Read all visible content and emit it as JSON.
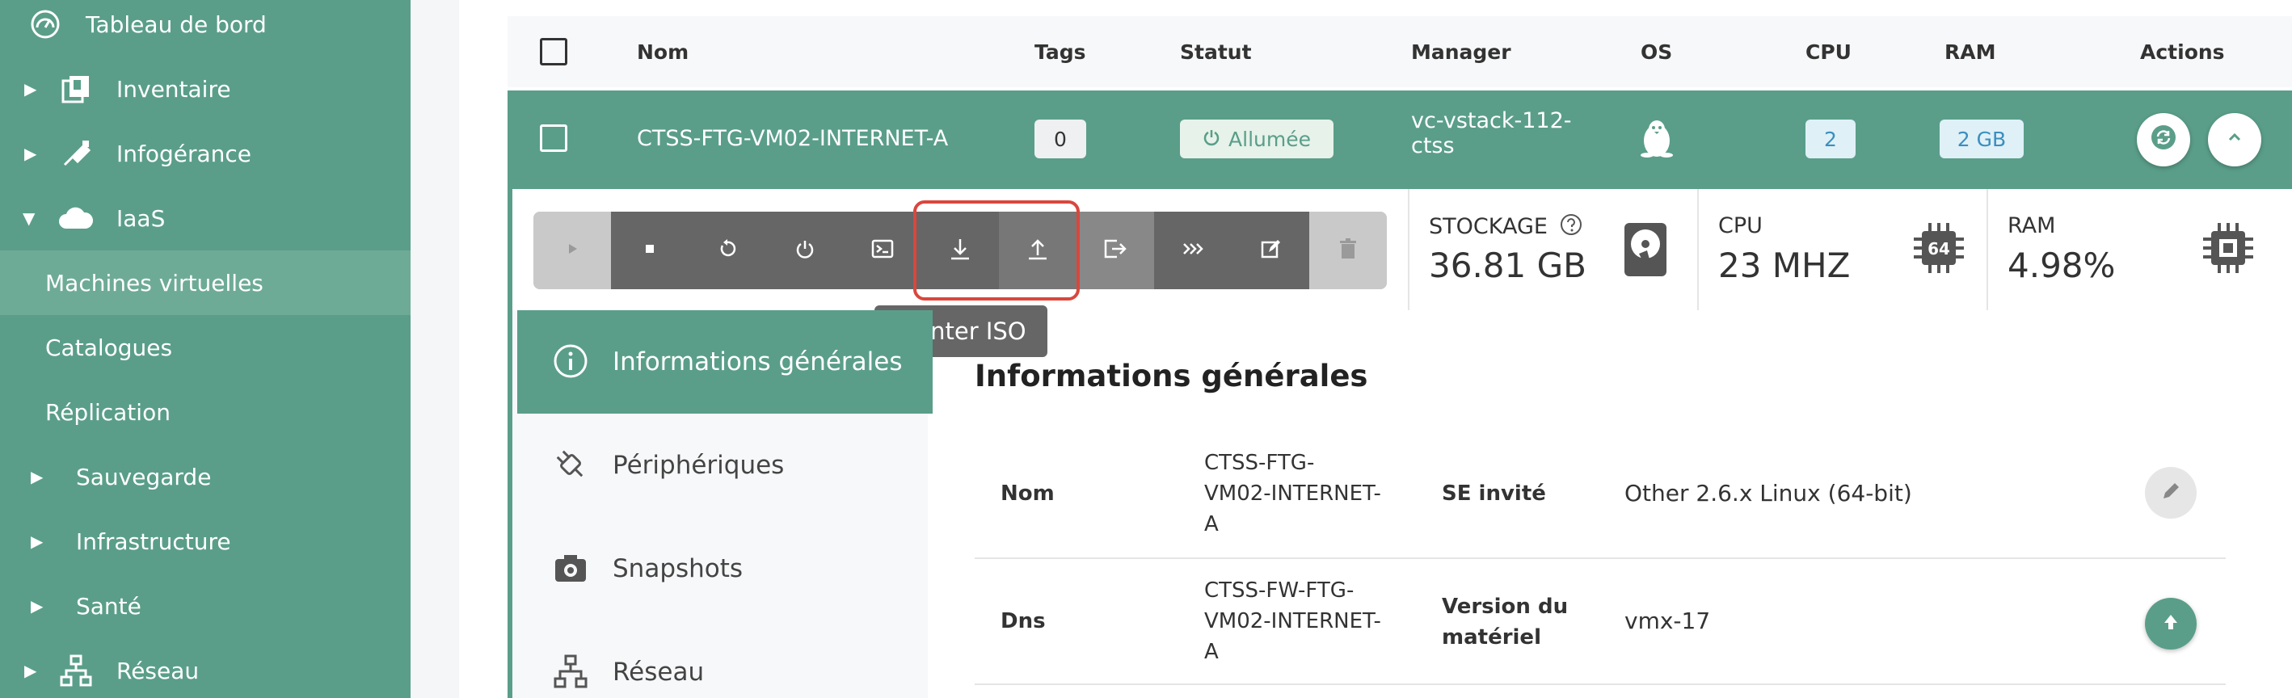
{
  "sidebar": {
    "items": [
      {
        "label": "Tableau de bord",
        "icon": "dashboard-icon"
      },
      {
        "label": "Inventaire",
        "icon": "inventory-icon"
      },
      {
        "label": "Infogérance",
        "icon": "managed-services-icon"
      },
      {
        "label": "IaaS",
        "icon": "cloud-icon"
      },
      {
        "label": "Machines virtuelles"
      },
      {
        "label": "Catalogues"
      },
      {
        "label": "Réplication"
      },
      {
        "label": "Sauvegarde"
      },
      {
        "label": "Infrastructure"
      },
      {
        "label": "Santé"
      },
      {
        "label": "Réseau",
        "icon": "network-icon"
      }
    ]
  },
  "table": {
    "headers": {
      "nom": "Nom",
      "tags": "Tags",
      "statut": "Statut",
      "manager": "Manager",
      "os": "OS",
      "cpu": "CPU",
      "ram": "RAM",
      "actions": "Actions"
    },
    "row": {
      "name": "CTSS-FTG-VM02-INTERNET-A",
      "tags": "0",
      "status": "Allumée",
      "manager_line1": "vc-vstack-112-",
      "manager_line2": "ctss",
      "os_icon": "linux-penguin-icon",
      "cpu": "2",
      "ram": "2 GB"
    }
  },
  "toolbar": {
    "buttons": [
      "play-icon",
      "stop-icon",
      "restart-icon",
      "power-icon",
      "console-icon",
      "mount-iso-icon",
      "unmount-iso-icon",
      "export-icon",
      "migrate-icon",
      "edit-icon",
      "delete-icon"
    ],
    "tooltip": "Monter ISO"
  },
  "stats": {
    "storage_label": "STOCKAGE",
    "storage_value": "36.81 GB",
    "cpu_label": "CPU",
    "cpu_value": "23 MHZ",
    "cpu_chip": "64",
    "ram_label": "RAM",
    "ram_value": "4.98%"
  },
  "tabs": [
    {
      "label": "Informations générales",
      "icon": "info-icon"
    },
    {
      "label": "Périphériques",
      "icon": "plug-icon"
    },
    {
      "label": "Snapshots",
      "icon": "camera-icon"
    },
    {
      "label": "Réseau",
      "icon": "network-icon"
    }
  ],
  "info": {
    "title": "Informations générales",
    "rows": [
      {
        "label1": "Nom",
        "value1_l1": "CTSS-FTG-",
        "value1_l2": "VM02-INTERNET-",
        "value1_l3": "A",
        "label2": "SE invité",
        "value2": "Other 2.6.x Linux (64-bit)"
      },
      {
        "label1": "Dns",
        "value1_l1": "CTSS-FW-FTG-",
        "value1_l2": "VM02-INTERNET-",
        "value1_l3": "A",
        "label2_l1": "Version du",
        "label2_l2": "matériel",
        "value2": "vmx-17"
      }
    ]
  },
  "colors": {
    "accent": "#5a9e89",
    "accent_light": "#6eab97",
    "highlight": "#d9473d"
  }
}
